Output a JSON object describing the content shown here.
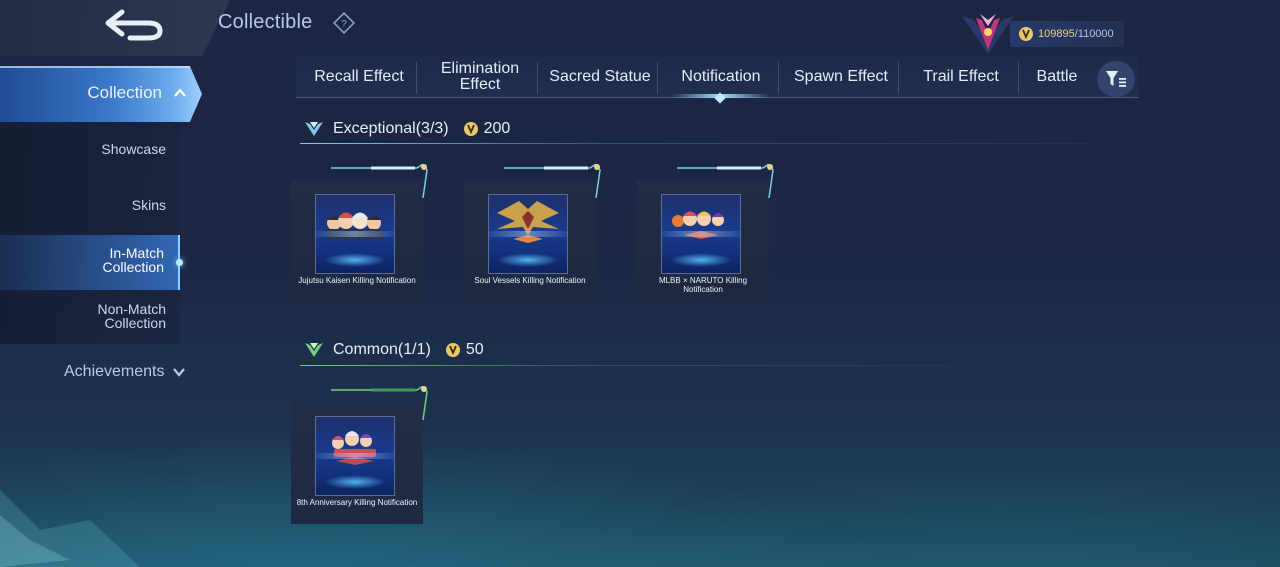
{
  "header": {
    "title": "Collectible",
    "currency_value": "109895",
    "currency_max": "/110000"
  },
  "sidebar": {
    "collection_label": "Collection",
    "items": [
      {
        "label": "Showcase"
      },
      {
        "label": "Skins"
      },
      {
        "label": "In-Match Collection",
        "active": true
      },
      {
        "label": "Non-Match Collection"
      }
    ],
    "achievements_label": "Achievements"
  },
  "tabs": [
    {
      "label": "Recall Effect"
    },
    {
      "label": "Elimination Effect"
    },
    {
      "label": "Sacred Statue"
    },
    {
      "label": "Notification",
      "active": true
    },
    {
      "label": "Spawn Effect"
    },
    {
      "label": "Trail Effect"
    },
    {
      "label": "Battle"
    }
  ],
  "sections": [
    {
      "title": "Exceptional(3/3)",
      "points": "200",
      "color": "#7fcde8",
      "items": [
        {
          "name": "Jujutsu Kaisen Killing Notification"
        },
        {
          "name": "Soul Vessels Killing Notification"
        },
        {
          "name": "MLBB × NARUTO Killing Notification"
        }
      ]
    },
    {
      "title": "Common(1/1)",
      "points": "50",
      "color": "#6fd27a",
      "items": [
        {
          "name": "8th Anniversary Killing Notification"
        }
      ]
    }
  ],
  "colors": {
    "accent": "#4f8fdc",
    "gold": "#e9d38a",
    "exceptional": "#7fcde8",
    "common": "#6fd27a"
  },
  "icons": [
    "back-arrow-icon",
    "help-icon",
    "rank-emblem-icon",
    "coin-icon",
    "chevron-up-icon",
    "chevron-down-icon",
    "filter-icon",
    "rarity-gem-icon"
  ]
}
